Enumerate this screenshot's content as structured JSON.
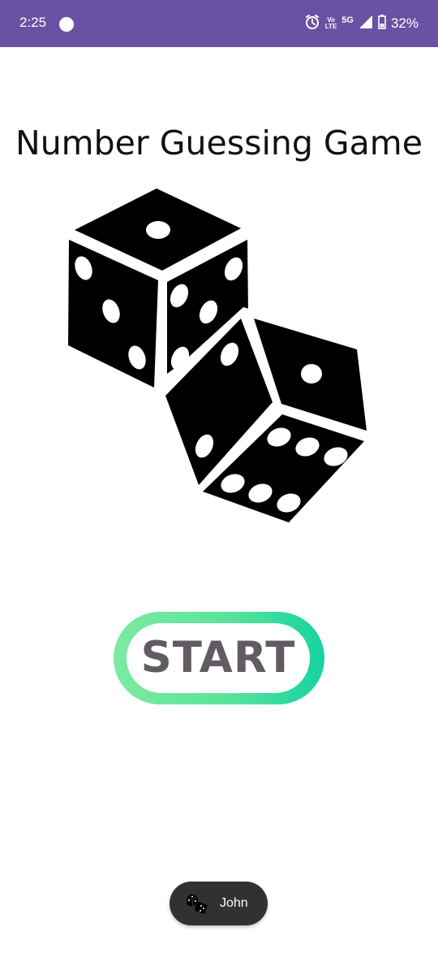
{
  "status_bar": {
    "time": "2:25",
    "network_top": "Vo",
    "network_bottom": "LTE",
    "network_type": "5G",
    "battery_percent": "32%",
    "background_color": "#6a51a3"
  },
  "screen": {
    "title": "Number Guessing Game",
    "hero_image": "dice-icon",
    "start_button_label": "START",
    "start_button_colors": [
      "#7deaa0",
      "#15d3a2"
    ],
    "start_text_color": "#625b61"
  },
  "toast": {
    "icon": "dice-icon",
    "text": "John"
  }
}
